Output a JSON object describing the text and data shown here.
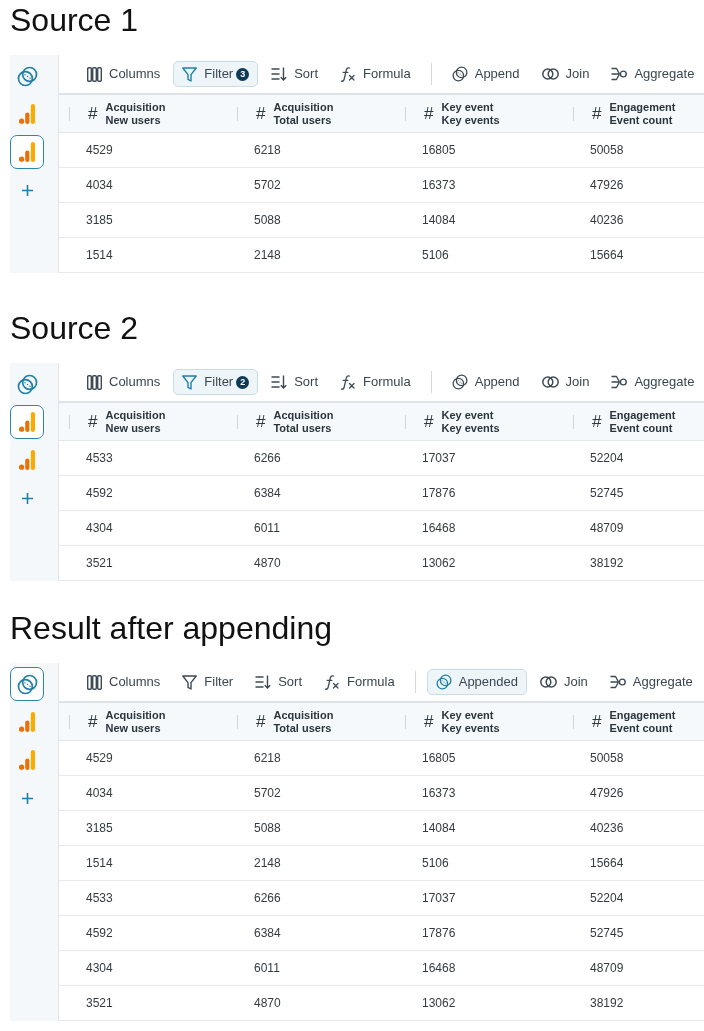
{
  "sections": [
    {
      "title": "Source 1",
      "sources": [
        {
          "kind": "append",
          "selected": false
        },
        {
          "kind": "analytics",
          "selected": false
        },
        {
          "kind": "analytics",
          "selected": true
        }
      ],
      "tools": [
        {
          "kind": "columns",
          "label": "Columns",
          "active": false
        },
        {
          "kind": "filter",
          "label": "Filter",
          "badge": "3",
          "active": true
        },
        {
          "kind": "sort",
          "label": "Sort",
          "active": false
        },
        {
          "kind": "formula",
          "label": "Formula",
          "active": false
        }
      ],
      "actions": [
        {
          "kind": "append",
          "label": "Append",
          "active": false
        },
        {
          "kind": "join",
          "label": "Join",
          "active": false
        },
        {
          "kind": "aggregate",
          "label": "Aggregate",
          "active": false
        }
      ],
      "columns": [
        {
          "symbol": "#",
          "group": "Acquisition",
          "name": "New users"
        },
        {
          "symbol": "#",
          "group": "Acquisition",
          "name": "Total users"
        },
        {
          "symbol": "#",
          "group": "Key event",
          "name": "Key events"
        },
        {
          "symbol": "#",
          "group": "Engagement",
          "name": "Event count"
        }
      ],
      "rows": [
        [
          "4529",
          "6218",
          "16805",
          "50058"
        ],
        [
          "4034",
          "5702",
          "16373",
          "47926"
        ],
        [
          "3185",
          "5088",
          "14084",
          "40236"
        ],
        [
          "1514",
          "2148",
          "5106",
          "15664"
        ]
      ]
    },
    {
      "title": "Source 2",
      "sources": [
        {
          "kind": "append",
          "selected": false
        },
        {
          "kind": "analytics",
          "selected": true
        },
        {
          "kind": "analytics",
          "selected": false
        }
      ],
      "tools": [
        {
          "kind": "columns",
          "label": "Columns",
          "active": false
        },
        {
          "kind": "filter",
          "label": "Filter",
          "badge": "2",
          "active": true
        },
        {
          "kind": "sort",
          "label": "Sort",
          "active": false
        },
        {
          "kind": "formula",
          "label": "Formula",
          "active": false
        }
      ],
      "actions": [
        {
          "kind": "append",
          "label": "Append",
          "active": false
        },
        {
          "kind": "join",
          "label": "Join",
          "active": false
        },
        {
          "kind": "aggregate",
          "label": "Aggregate",
          "active": false
        }
      ],
      "columns": [
        {
          "symbol": "#",
          "group": "Acquisition",
          "name": "New users"
        },
        {
          "symbol": "#",
          "group": "Acquisition",
          "name": "Total users"
        },
        {
          "symbol": "#",
          "group": "Key event",
          "name": "Key events"
        },
        {
          "symbol": "#",
          "group": "Engagement",
          "name": "Event count"
        }
      ],
      "rows": [
        [
          "4533",
          "6266",
          "17037",
          "52204"
        ],
        [
          "4592",
          "6384",
          "17876",
          "52745"
        ],
        [
          "4304",
          "6011",
          "16468",
          "48709"
        ],
        [
          "3521",
          "4870",
          "13062",
          "38192"
        ]
      ]
    },
    {
      "title": "Result after appending",
      "sources": [
        {
          "kind": "append",
          "selected": true
        },
        {
          "kind": "analytics",
          "selected": false
        },
        {
          "kind": "analytics",
          "selected": false
        }
      ],
      "tools": [
        {
          "kind": "columns",
          "label": "Columns",
          "active": false
        },
        {
          "kind": "filter",
          "label": "Filter",
          "active": false
        },
        {
          "kind": "sort",
          "label": "Sort",
          "active": false
        },
        {
          "kind": "formula",
          "label": "Formula",
          "active": false
        }
      ],
      "actions": [
        {
          "kind": "append",
          "label": "Appended",
          "active": true
        },
        {
          "kind": "join",
          "label": "Join",
          "active": false
        },
        {
          "kind": "aggregate",
          "label": "Aggregate",
          "active": false
        }
      ],
      "columns": [
        {
          "symbol": "#",
          "group": "Acquisition",
          "name": "New users"
        },
        {
          "symbol": "#",
          "group": "Acquisition",
          "name": "Total users"
        },
        {
          "symbol": "#",
          "group": "Key event",
          "name": "Key events"
        },
        {
          "symbol": "#",
          "group": "Engagement",
          "name": "Event count"
        }
      ],
      "rows": [
        [
          "4529",
          "6218",
          "16805",
          "50058"
        ],
        [
          "4034",
          "5702",
          "16373",
          "47926"
        ],
        [
          "3185",
          "5088",
          "14084",
          "40236"
        ],
        [
          "1514",
          "2148",
          "5106",
          "15664"
        ],
        [
          "4533",
          "6266",
          "17037",
          "52204"
        ],
        [
          "4592",
          "6384",
          "17876",
          "52745"
        ],
        [
          "4304",
          "6011",
          "16468",
          "48709"
        ],
        [
          "3521",
          "4870",
          "13062",
          "38192"
        ]
      ]
    }
  ]
}
